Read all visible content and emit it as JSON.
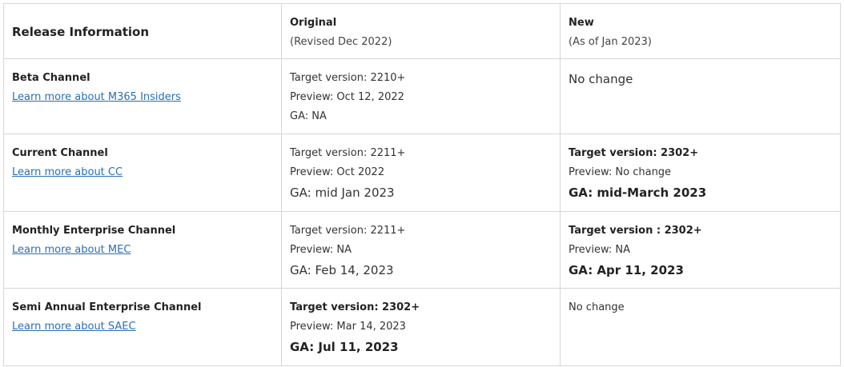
{
  "header": {
    "col1": "Release Information",
    "col2_title": "Original",
    "col2_sub": "(Revised Dec 2022)",
    "col3_title": "New",
    "col3_sub": "(As of Jan 2023)"
  },
  "rows": [
    {
      "channel": "Beta Channel",
      "link": "Learn more about M365 Insiders",
      "orig_target": "Target version: 2210+",
      "orig_preview": "Preview: Oct 12, 2022",
      "orig_ga": "GA: NA",
      "new_text": "No change"
    },
    {
      "channel": "Current Channel",
      "link": "Learn more about CC",
      "orig_target": "Target version: 2211+",
      "orig_preview": "Preview: Oct 2022",
      "orig_ga": "GA: mid Jan 2023",
      "new_target": "Target version: 2302+",
      "new_preview": "Preview: No change",
      "new_ga": "GA: mid-March 2023"
    },
    {
      "channel": "Monthly Enterprise Channel",
      "link": "Learn more about MEC",
      "orig_target": "Target version: 2211+",
      "orig_preview": "Preview: NA",
      "orig_ga": "GA: Feb 14, 2023",
      "new_target": "Target version : 2302+",
      "new_preview": "Preview: NA",
      "new_ga": "GA: Apr 11, 2023"
    },
    {
      "channel": "Semi Annual Enterprise Channel",
      "link": "Learn more about SAEC",
      "orig_target": "Target version: 2302+",
      "orig_preview": "Preview: Mar 14, 2023",
      "orig_ga": "GA: Jul 11, 2023",
      "new_text": "No change"
    }
  ],
  "colors": {
    "link": "#2a6fb3",
    "border": "#d6d6d6",
    "text": "#333333"
  }
}
